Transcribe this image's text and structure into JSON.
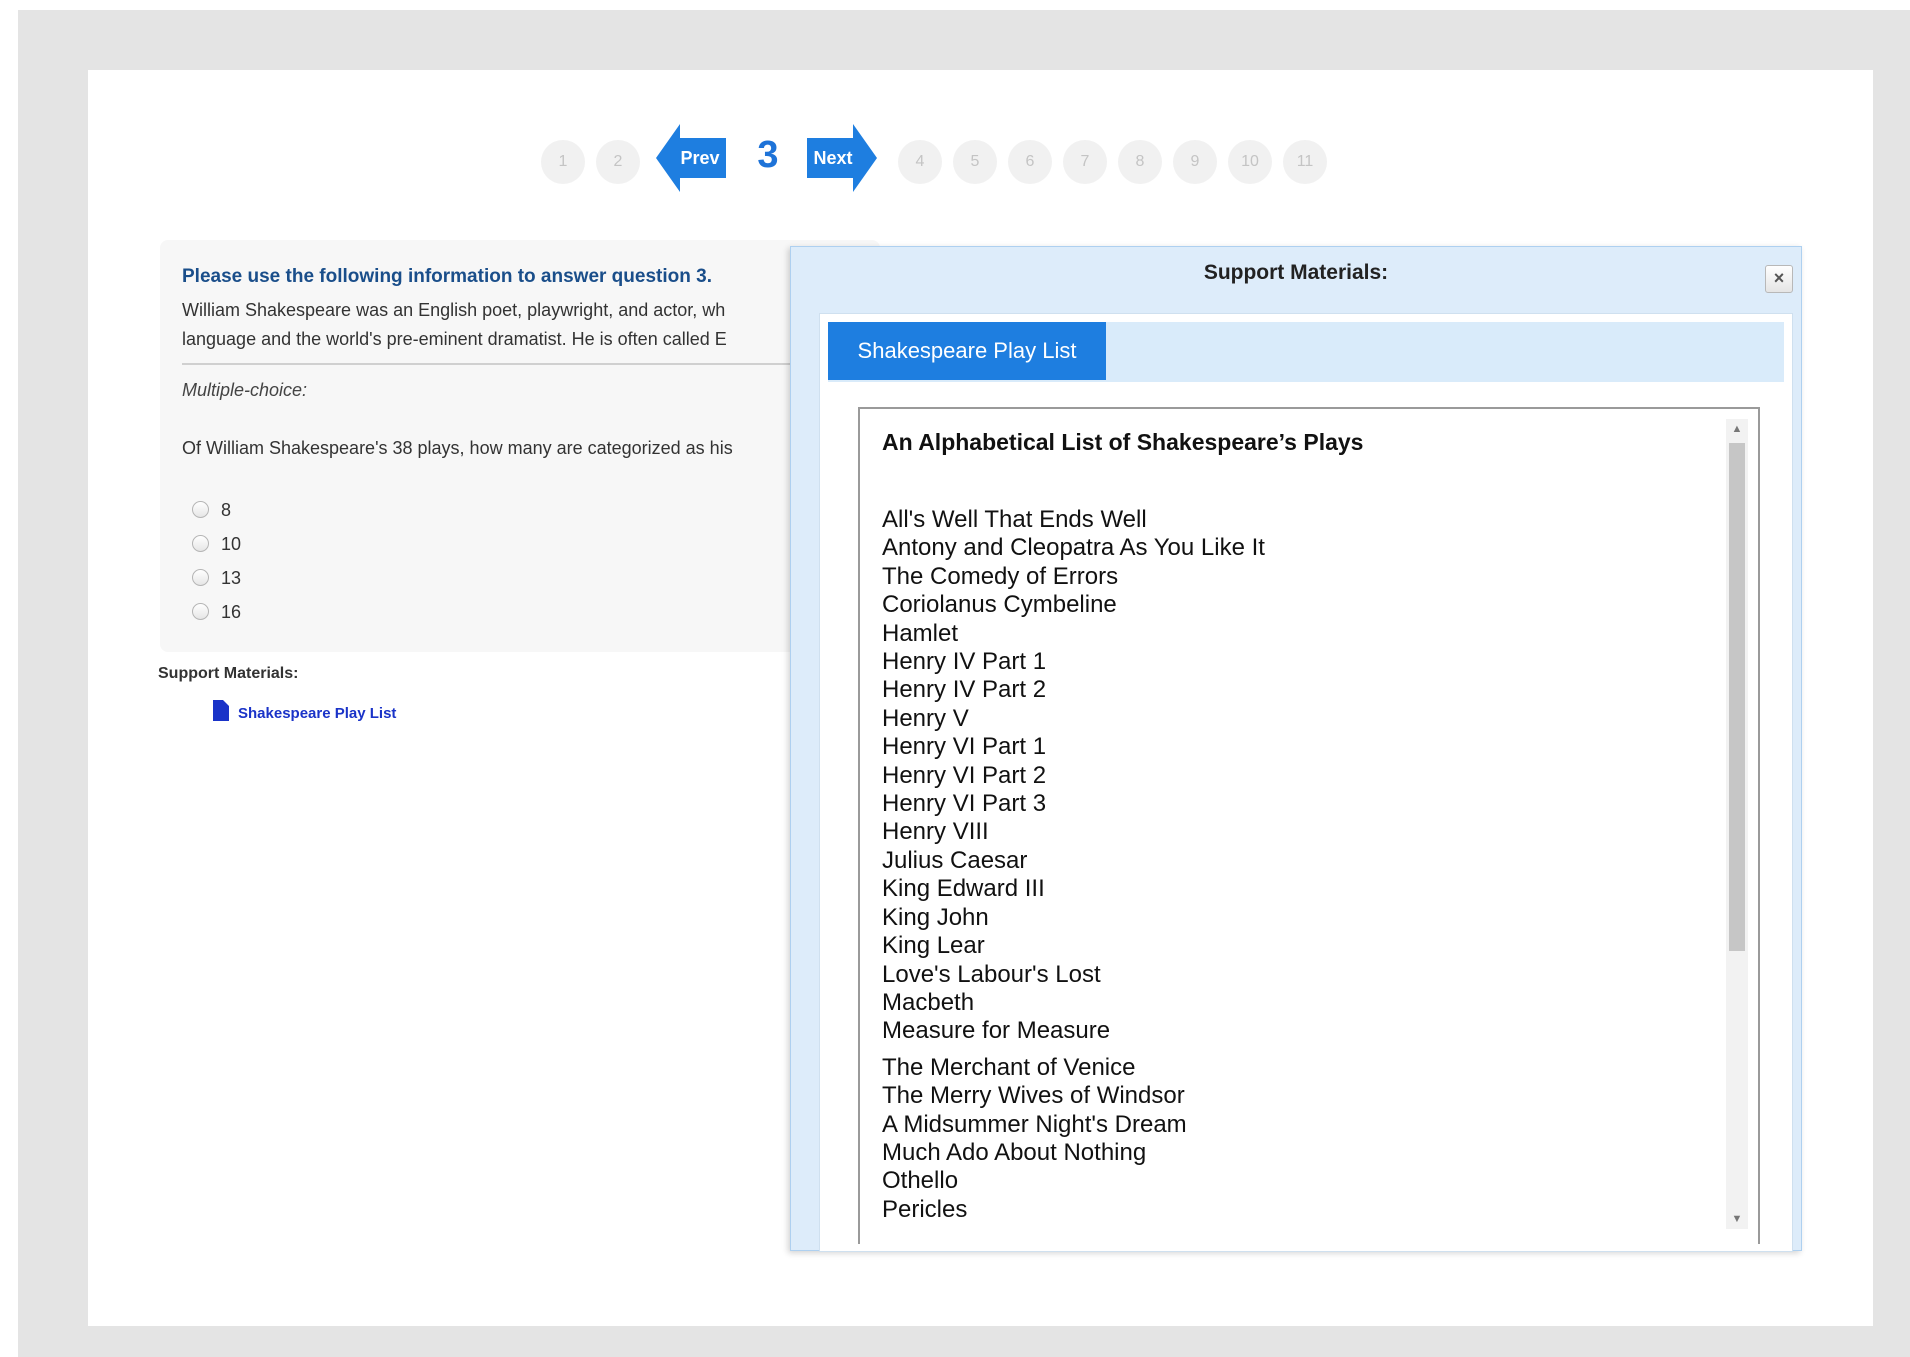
{
  "pagination": {
    "pages_before": [
      "1",
      "2"
    ],
    "prev_label": "Prev",
    "current": "3",
    "next_label": "Next",
    "pages_after": [
      "4",
      "5",
      "6",
      "7",
      "8",
      "9",
      "10",
      "11"
    ]
  },
  "question": {
    "title": "Please use the following information to answer question 3.",
    "passage_line1": "William Shakespeare was an English poet, playwright, and actor, wh",
    "passage_line2": "language and the world's pre-eminent dramatist. He is often called E",
    "type_label": "Multiple-choice:",
    "text": "Of William Shakespeare's 38 plays, how many are categorized as his",
    "options": [
      "8",
      "10",
      "13",
      "16"
    ]
  },
  "support_materials": {
    "label": "Support Materials:",
    "link_label": "Shakespeare Play List"
  },
  "dialog": {
    "title": "Support Materials:",
    "close_glyph": "×",
    "tab_label": "Shakespeare Play List",
    "doc_title": "An Alphabetical List of Shakespeare’s Plays",
    "plays": [
      "All's Well That Ends Well",
      "Antony and Cleopatra As You Like It",
      "The Comedy of Errors",
      "Coriolanus Cymbeline",
      "Hamlet",
      "Henry IV Part 1",
      "Henry IV Part 2",
      "Henry V",
      "Henry VI Part 1",
      "Henry VI Part 2",
      "Henry VI Part 3",
      "Henry VIII",
      "Julius Caesar",
      "King Edward III",
      "King John",
      "King Lear",
      "Love's Labour's Lost",
      "Macbeth",
      "Measure for Measure",
      "The Merchant of Venice",
      "The Merry Wives of Windsor",
      "A Midsummer Night's Dream",
      "Much Ado About Nothing",
      "Othello",
      "Pericles"
    ]
  },
  "colors": {
    "accent": "#1e7ee0",
    "link": "#1a33c8",
    "title_text": "#1a4e8a",
    "dialog_bg": "#ddecfa"
  }
}
